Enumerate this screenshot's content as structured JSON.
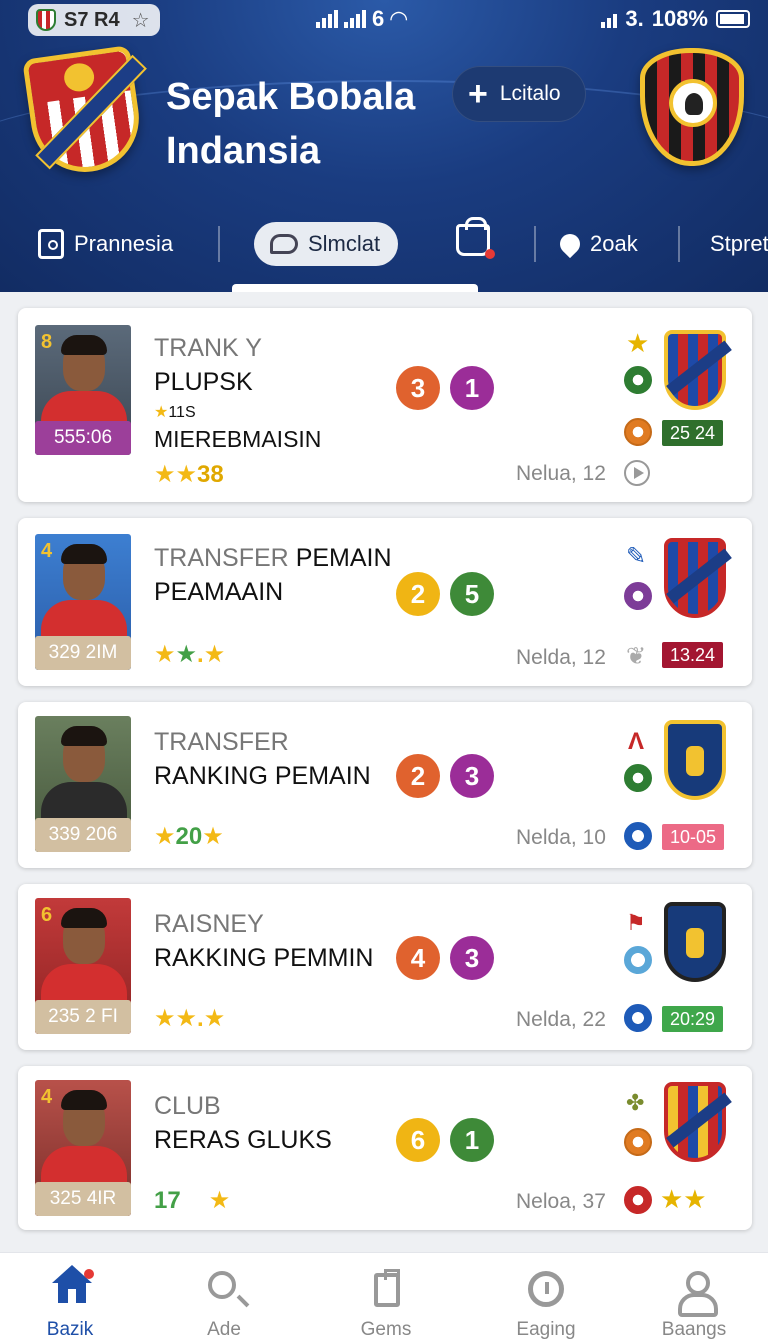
{
  "status": {
    "left": "S7 R4",
    "center": "6",
    "right": "108%",
    "signal_text": "3."
  },
  "header": {
    "title_line1": "Sepak Bobala",
    "title_line2": "Indansia",
    "action_label": "Lcitalo"
  },
  "tabs": [
    {
      "label": "Prannesia"
    },
    {
      "label": "Slmclat"
    },
    {
      "label": "2oak"
    },
    {
      "label": "Stpret"
    }
  ],
  "cards": [
    {
      "line1": "TRANK Y",
      "line2": "PLUPSK",
      "line3": "11S",
      "line4": "MIEREBMAISIN",
      "tag": "555:06",
      "rating": "38",
      "score_a": "3",
      "score_b": "1",
      "meta": "Nelua, 12",
      "badge": "25 24",
      "photo_num": "8"
    },
    {
      "line1": "TRANSFER",
      "line1b": "PEMAIN",
      "line2": "PEAMAAIN",
      "tag": "329 2IM",
      "score_a": "2",
      "score_b": "5",
      "meta": "Nelda, 12",
      "badge": "13.24",
      "photo_num": "4"
    },
    {
      "line1": "TRANSFER",
      "line2": "RANKING PEMAIN",
      "tag": "339 206",
      "rating": "20",
      "score_a": "2",
      "score_b": "3",
      "meta": "Nelda, 10",
      "badge": "10-05"
    },
    {
      "line1": "RAISNEY",
      "line2": "RAKKING PEMMIN",
      "tag": "235 2 FI",
      "score_a": "4",
      "score_b": "3",
      "meta": "Nelda, 22",
      "badge": "20:29",
      "photo_num": "6"
    },
    {
      "line1": "CLUB",
      "line2": "RERAS GLUKS",
      "tag": "325 4IR",
      "rating": "17",
      "score_a": "6",
      "score_b": "1",
      "meta": "Neloa, 37",
      "photo_num": "4"
    }
  ],
  "bottom_nav": [
    {
      "label": "Bazik"
    },
    {
      "label": "Ade"
    },
    {
      "label": "Gems"
    },
    {
      "label": "Eaging"
    },
    {
      "label": "Baangs"
    }
  ],
  "colors": {
    "header": "#1a3c80",
    "accent": "#1e4fa8",
    "orange": "#e0622e",
    "purple": "#9b2d98",
    "yellow": "#f0b514",
    "green": "#3e8a38"
  }
}
